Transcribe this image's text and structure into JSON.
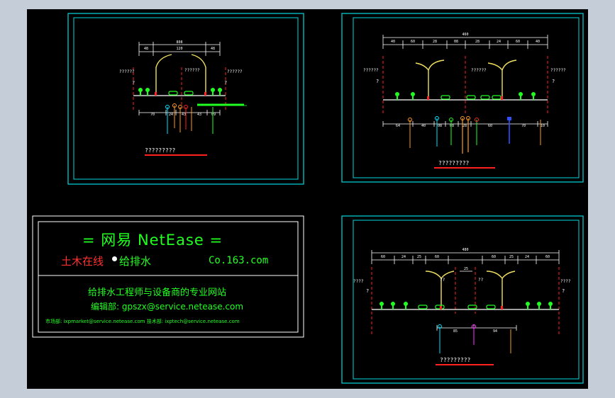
{
  "colors": {
    "background": "#000000",
    "frame": "#00d8e0",
    "text_line": "#ffffff",
    "pole": "#f0e060",
    "red": "#ff2020",
    "green": "#20ff20",
    "orange": "#ff9a20",
    "cyan": "#00e0ff",
    "magenta": "#ff30ff",
    "blue": "#3050ff",
    "credit_green": "#40ff40",
    "credit_red": "#ff3030"
  },
  "panel1": {
    "dims_top": {
      "total": "808",
      "a": "48",
      "b": "120",
      "c": "48"
    },
    "labels": {
      "left": "??????",
      "center": "??????",
      "right": "??????",
      "q_left": "?",
      "q_right": "?"
    },
    "dims_bottom": [
      "70",
      "24",
      "43",
      "43",
      "09"
    ],
    "caption": "?????????"
  },
  "panel2": {
    "dims_top": {
      "total": "460",
      "segs": [
        "40",
        "60",
        "28",
        "08",
        "28",
        "24",
        "60",
        "40"
      ]
    },
    "labels": {
      "left": "??????",
      "center": "??????",
      "right": "??????",
      "q_left": "?",
      "q_right": "?"
    },
    "dims_bottom": [
      "64",
      "40",
      "08",
      "08",
      "28",
      "60",
      "70",
      "10"
    ],
    "caption": "?????????"
  },
  "panel3": {
    "dims_top": {
      "total": "480",
      "segs": [
        "60",
        "24",
        "25",
        "60",
        "60",
        "25",
        "24",
        "60"
      ],
      "mid": "25"
    },
    "labels": {
      "left": "????",
      "center_a": "??",
      "center_b": "??",
      "right": "????",
      "q_left": "?",
      "q_right": "?"
    },
    "dims_bottom": [
      "85",
      "94"
    ],
    "caption": "?????????"
  },
  "credit": {
    "title": "=  网易 NetEase  =",
    "line2_left": "土木在线",
    "line2_mid": "给排水",
    "line2_right": "Co.163.com",
    "line3": "给排水工程师与设备商的专业网站",
    "line4": "编辑部: gpszx@service.netease.com",
    "line5": "市场部: ixpmarket@service.netease.com    技术部: ixptech@service.netease.com"
  }
}
